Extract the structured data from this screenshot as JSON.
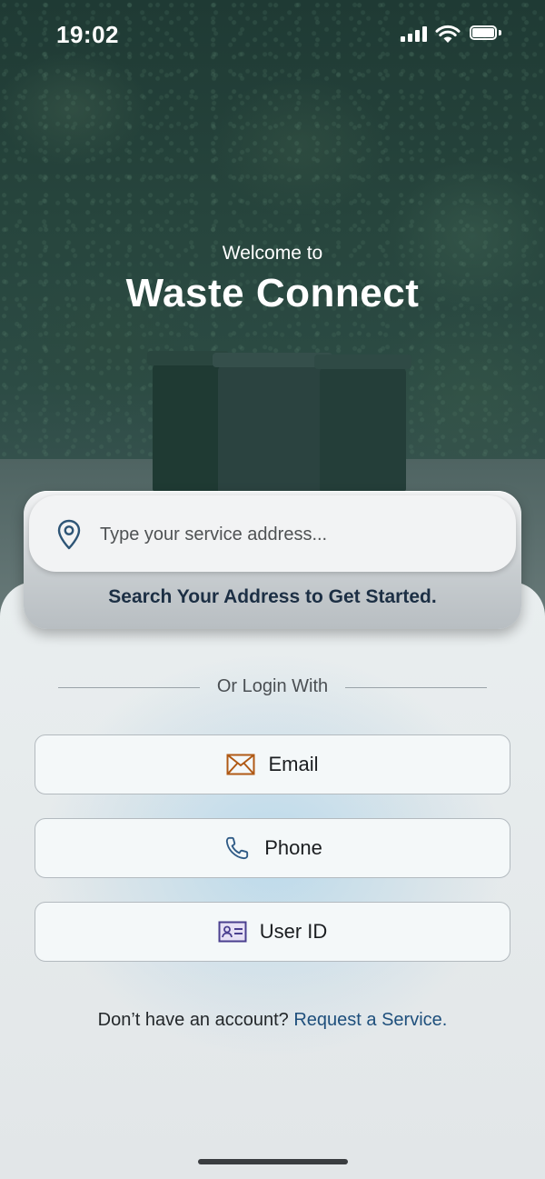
{
  "status_bar": {
    "time": "19:02",
    "icons": [
      "cellular-signal-icon",
      "wifi-icon",
      "battery-icon"
    ]
  },
  "hero": {
    "welcome": "Welcome to",
    "title": "Waste Connect"
  },
  "search": {
    "icon": "map-pin-icon",
    "placeholder": "Type your service address...",
    "value": "",
    "caption": "Search Your Address to Get Started."
  },
  "login": {
    "divider_label": "Or Login With",
    "options": [
      {
        "label": "Email",
        "icon": "envelope-icon",
        "icon_color": "#b05a16"
      },
      {
        "label": "Phone",
        "icon": "phone-icon",
        "icon_color": "#2f5b86"
      },
      {
        "label": "User ID",
        "icon": "id-card-icon",
        "icon_color": "#4a3f8f"
      }
    ]
  },
  "signup": {
    "prompt": "Don’t have an account?",
    "link": "Request a Service."
  },
  "colors": {
    "link": "#1e4f7c",
    "caption": "#1c2f44"
  }
}
